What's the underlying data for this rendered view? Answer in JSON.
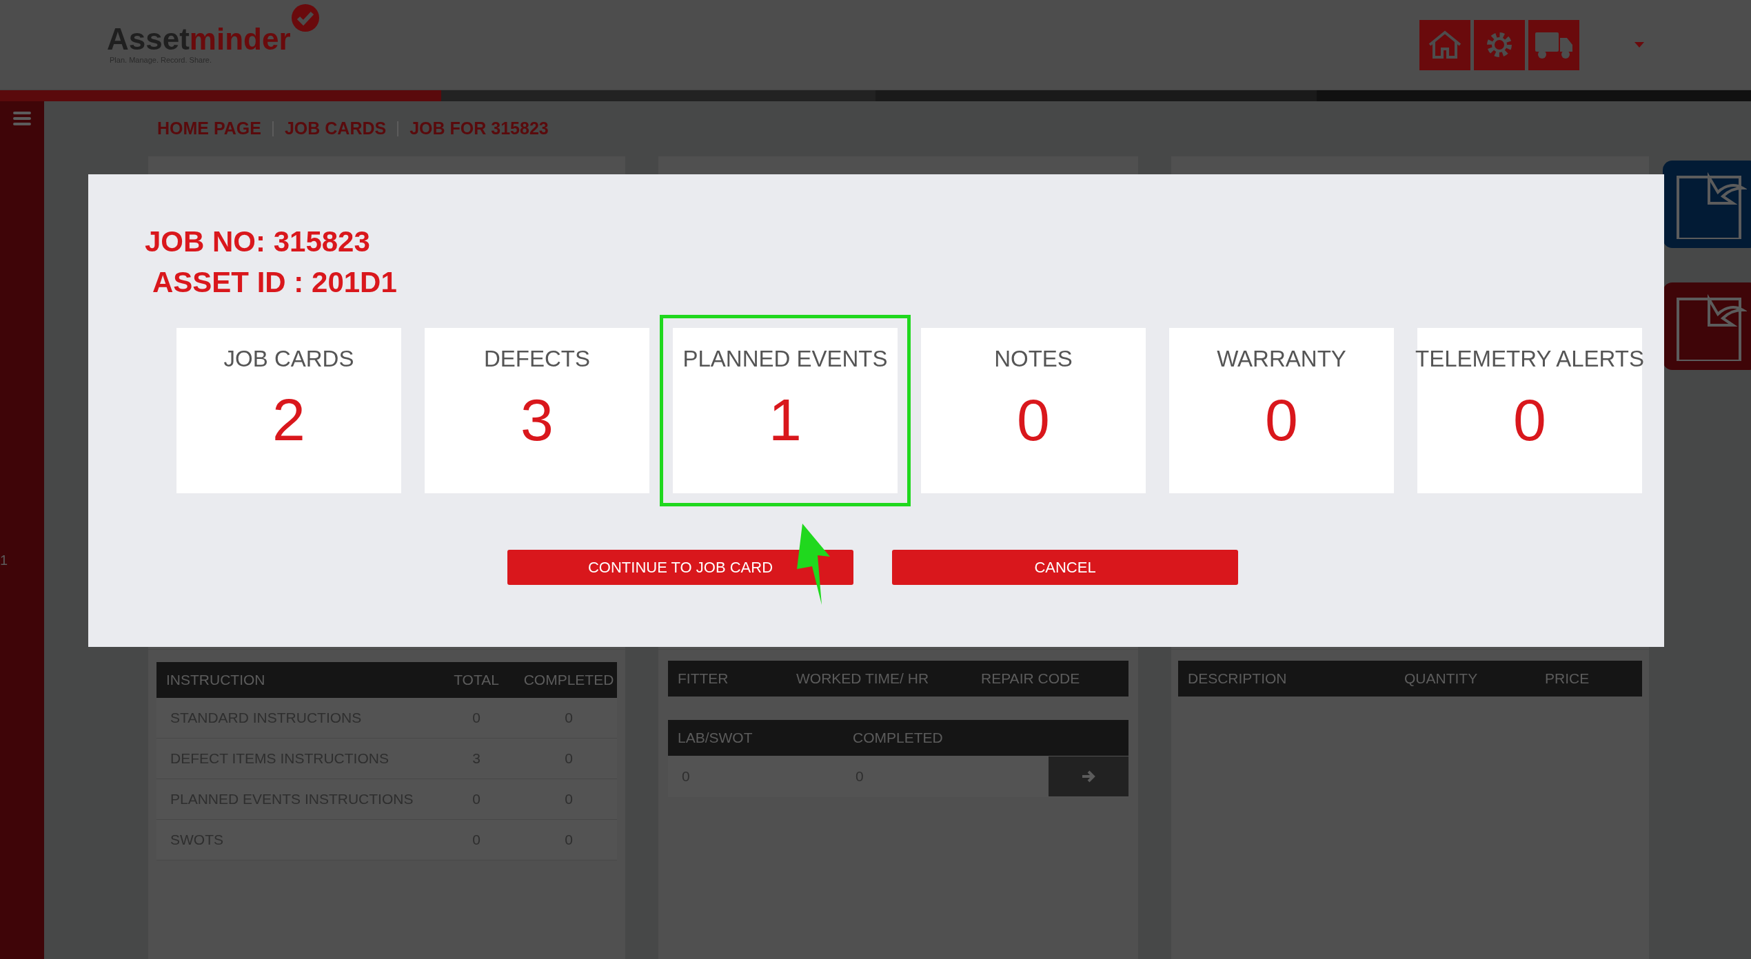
{
  "header": {
    "logo": [
      "Asset",
      "minder"
    ],
    "tagline": "Plan. Manage. Record. Share."
  },
  "breadcrumb": [
    "HOME PAGE",
    "JOB CARDS",
    "JOB FOR 315823"
  ],
  "sidebar": {
    "page_number": "1"
  },
  "instructions": {
    "columns": [
      "INSTRUCTION",
      "TOTAL",
      "COMPLETED"
    ],
    "rows": [
      [
        "STANDARD INSTRUCTIONS",
        "0",
        "0"
      ],
      [
        "DEFECT ITEMS INSTRUCTIONS",
        "3",
        "0"
      ],
      [
        "PLANNED EVENTS INSTRUCTIONS",
        "0",
        "0"
      ],
      [
        "SWOTS",
        "0",
        "0"
      ]
    ]
  },
  "labour": {
    "columns": [
      "FITTER",
      "WORKED TIME/ HR",
      "REPAIR CODE"
    ],
    "summary_columns": [
      "LAB/SWOT",
      "COMPLETED"
    ],
    "summary_row": [
      "0",
      "0"
    ]
  },
  "parts": {
    "columns": [
      "DESCRIPTION",
      "QUANTITY",
      "PRICE"
    ]
  },
  "modal": {
    "job_no": "JOB NO: 315823",
    "asset_id": "ASSET ID : 201D1",
    "tiles": [
      {
        "label": "JOB CARDS",
        "count": "2",
        "highlighted": false
      },
      {
        "label": "DEFECTS",
        "count": "3",
        "highlighted": false
      },
      {
        "label": "PLANNED EVENTS",
        "count": "1",
        "highlighted": true
      },
      {
        "label": "NOTES",
        "count": "0",
        "highlighted": false
      },
      {
        "label": "WARRANTY",
        "count": "0",
        "highlighted": false
      },
      {
        "label": "TELEMETRY ALERTS",
        "count": "0",
        "highlighted": false
      }
    ],
    "buttons": [
      "CONTINUE TO JOB CARD",
      "CANCEL"
    ]
  }
}
